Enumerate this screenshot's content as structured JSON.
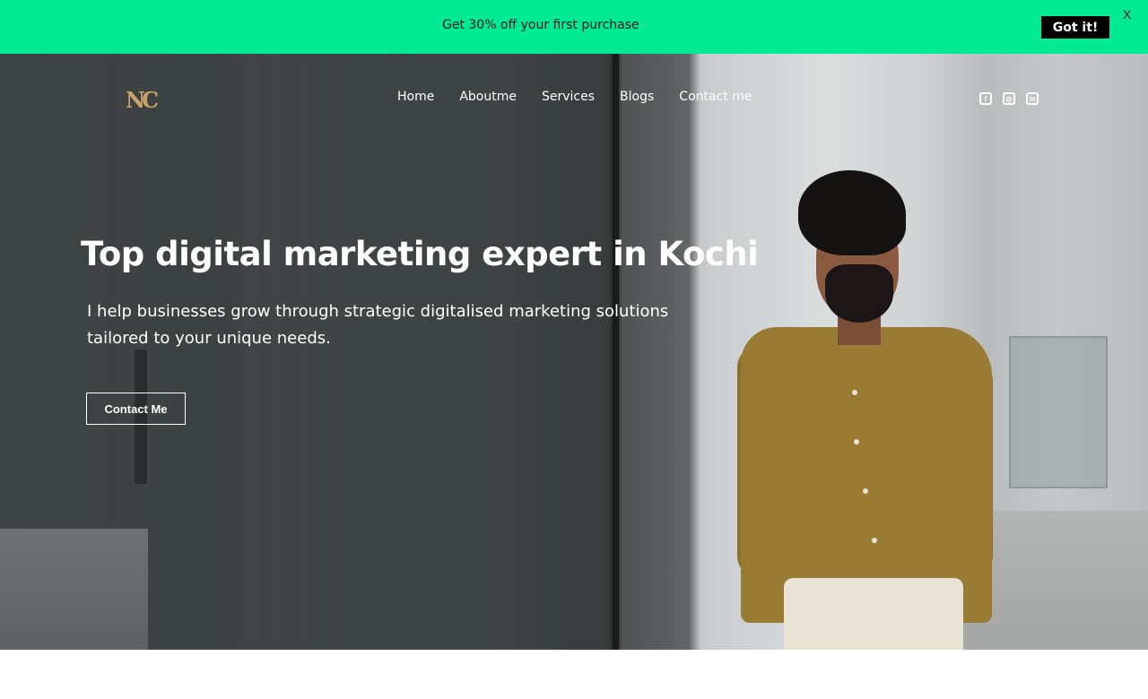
{
  "promo": {
    "text": "Get 30% off your first purchase",
    "button_label": "Got it!",
    "close_label": "X",
    "background_color": "#00e995"
  },
  "brand": {
    "logo_text": "NC",
    "logo_color": "#c9a46b"
  },
  "nav": {
    "items": [
      {
        "label": "Home"
      },
      {
        "label": "Aboutme"
      },
      {
        "label": "Services"
      },
      {
        "label": "Blogs"
      },
      {
        "label": "Contact me"
      }
    ]
  },
  "socials": [
    {
      "icon": "facebook-icon",
      "glyph": "f"
    },
    {
      "icon": "instagram-icon",
      "glyph": "◎"
    },
    {
      "icon": "linkedin-icon",
      "glyph": "in"
    }
  ],
  "hero": {
    "title": "Top digital marketing expert in Kochi",
    "subtitle": "I help businesses grow through strategic digitalised marketing solutions tailored to your unique needs.",
    "cta_label": "Contact Me"
  }
}
